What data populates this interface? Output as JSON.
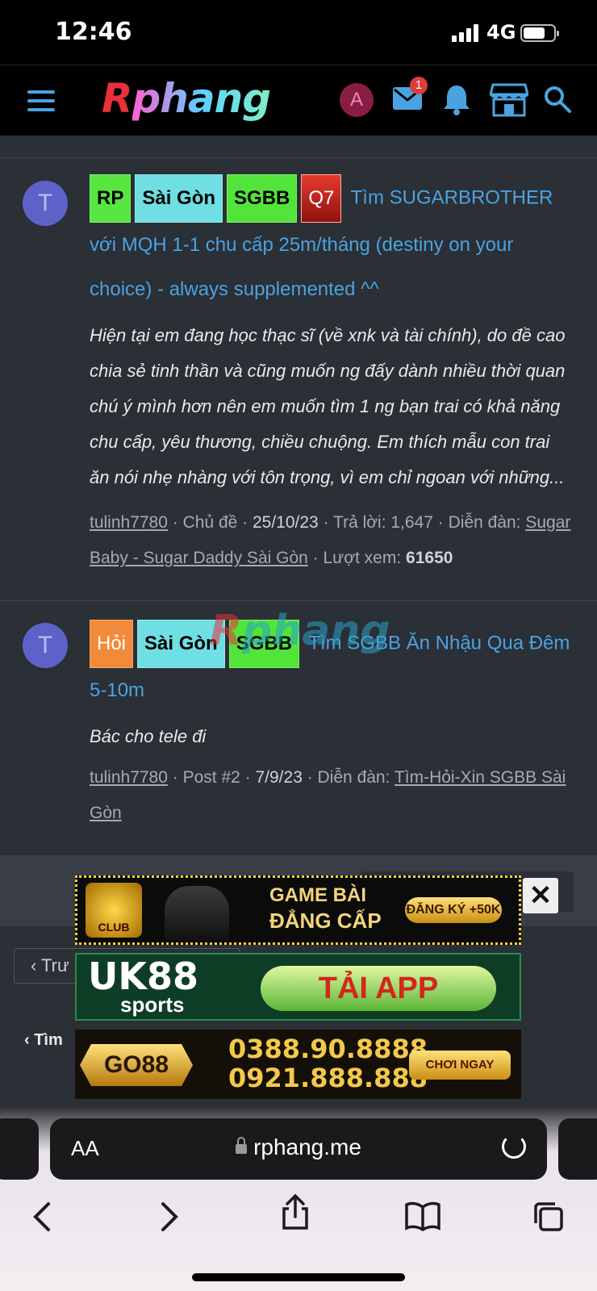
{
  "status": {
    "time": "12:46",
    "network": "4G"
  },
  "header": {
    "logo_r": "R",
    "logo_rest": "phang",
    "avatar_letter": "A",
    "mail_badge": "1"
  },
  "threads": [
    {
      "avatar_letter": "T",
      "prefixes": [
        "RP",
        "Sài Gòn",
        "SGBB",
        "Q7"
      ],
      "title": "Tìm SUGARBROTHER với MQH 1-1 chu cấp 25m/tháng (destiny on your choice) - always supplemented ^^",
      "snippet": "Hiện tại em đang học thạc sĩ (về xnk và tài chính), do đề cao chia sẻ tinh thần và cũng muốn ng đấy dành nhiều thời quan chú ý mình hơn nên em muốn tìm 1 ng bạn trai có khả năng chu cấp, yêu thương, chiều chuộng. Em thích mẫu con trai ăn nói nhẹ nhàng với tôn trọng, vì em chỉ ngoan với những...",
      "author": "tulinh7780",
      "kind": "Chủ đề",
      "date": "25/10/23",
      "replies_label": "Trả lời:",
      "replies": "1,647",
      "forum_label": "Diễn đàn:",
      "forum": "Sugar Baby - Sugar Daddy Sài Gòn",
      "views_label": "Lượt xem:",
      "views": "61650"
    },
    {
      "avatar_letter": "T",
      "prefixes": [
        "Hỏi",
        "Sài Gòn",
        "SGBB"
      ],
      "title": "Tìm SGBB Ăn Nhậu Qua Đêm 5-10m",
      "snippet": "Bác cho tele đi",
      "author": "tulinh7780",
      "kind": "Post #2",
      "date": "7/9/23",
      "forum_label": "Diễn đàn:",
      "forum": "Tìm-Hỏi-Xin SGBB Sài Gòn"
    }
  ],
  "watermark": {
    "r": "R",
    "rest": "phang"
  },
  "pager": {
    "prev": "Trư"
  },
  "back_link": "Tìm",
  "ads": {
    "ad1_brand": "CLUB",
    "ad1_line1": "GAME BÀI",
    "ad1_line2": "ĐẲNG CẤP",
    "ad1_cta": "ĐĂNG KÝ +50K",
    "ad2_brand_top": "UK88",
    "ad2_brand_bottom": "sports",
    "ad2_cta": "TẢI APP",
    "ad3_brand": "GO88",
    "ad3_phone1": "0388.90.8888",
    "ad3_phone2": "0921.888.888",
    "ad3_cta": "CHƠI NGAY",
    "close": "✕"
  },
  "safari": {
    "aa": "AA",
    "url": "rphang.me"
  },
  "colors": {
    "link": "#4aa3e0",
    "background": "#2b2f36",
    "header": "#000000"
  }
}
